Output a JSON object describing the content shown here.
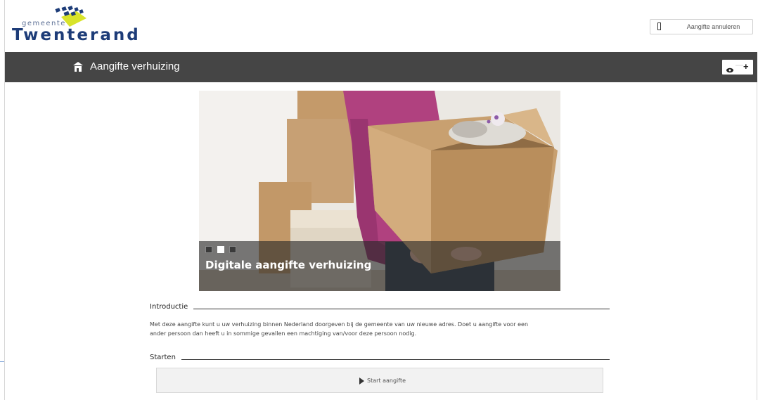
{
  "header": {
    "logo_small": "gemeente",
    "logo_big": "Twenterand",
    "cancel_label": "Aangifte annuleren",
    "colors": {
      "logo_blue": "#1d3c78",
      "logo_yellow": "#d8e32a"
    }
  },
  "titlebar": {
    "title": "Aangifte verhuizing",
    "icon": "house-icon",
    "a11y": {
      "eye_icon": "eye-icon",
      "minus": "—",
      "plus": "+"
    },
    "background": "#454545"
  },
  "hero": {
    "caption": "Digitale aangifte verhuizing",
    "slides": [
      {
        "active": false
      },
      {
        "active": true
      },
      {
        "active": false
      }
    ]
  },
  "intro": {
    "heading": "Introductie",
    "text": "Met deze aangifte kunt u uw verhuizing binnen Nederland doorgeven bij de gemeente van uw nieuwe adres. Doet u aangifte voor een ander persoon dan heeft u in sommige gevallen een machtiging van/voor deze persoon nodig."
  },
  "start": {
    "heading": "Starten",
    "button_label": "Start aangifte",
    "icon": "play-icon"
  }
}
